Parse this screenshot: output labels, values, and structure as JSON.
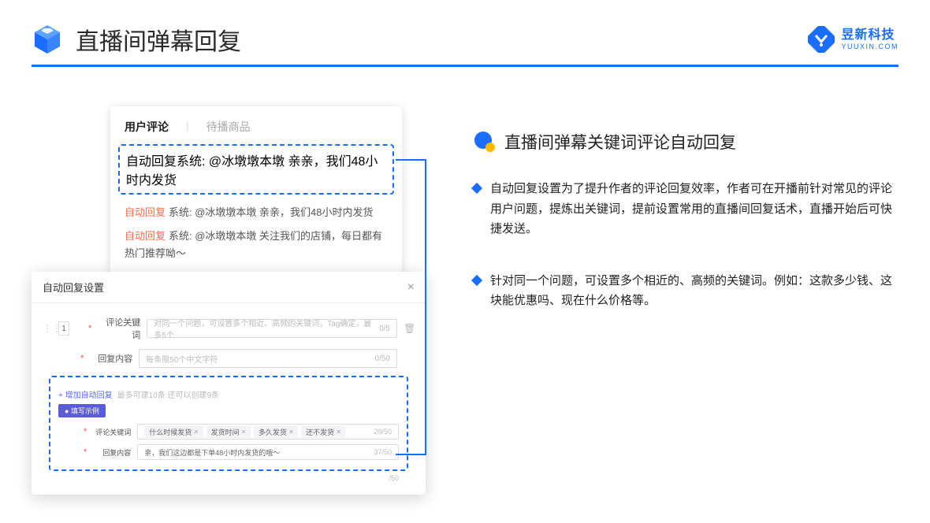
{
  "header": {
    "title": "直播间弹幕回复",
    "brand_name": "昱新科技",
    "brand_sub": "YUUXIN.COM"
  },
  "comments": {
    "tab_active": "用户评论",
    "tab_inactive": "待播商品",
    "items": [
      {
        "tag": "自动回复",
        "text": "系统: @冰墩墩本墩 亲亲，我们48小时内发货"
      },
      {
        "tag": "自动回复",
        "text": "系统: @冰墩墩本墩 亲亲，我们48小时内发货"
      },
      {
        "tag": "自动回复",
        "text": "系统: @冰墩墩本墩 关注我们的店铺，每日都有热门推荐呦～"
      }
    ]
  },
  "settings": {
    "title": "自动回复设置",
    "row_num": "1",
    "keyword_label": "评论关键词",
    "keyword_placeholder": "对同一个问题，可设置多个相近、高频的关键词，Tag确定，最多5个",
    "keyword_count": "0/5",
    "content_label": "回复内容",
    "content_placeholder": "每条限50个中文字符",
    "content_count": "0/50",
    "add_label": "+ 增加自动回复",
    "add_note": "最多可建10条 还可以创建9条",
    "example_badge": "● 填写示例",
    "ex_kw_label": "评论关键词",
    "ex_tags": [
      "什么时候发货",
      "发货时间",
      "多久发货",
      "还不发货"
    ],
    "ex_kw_count": "20/50",
    "ex_content_label": "回复内容",
    "ex_content": "亲，我们这边都是下单48小时内发货的哦～",
    "ex_content_count": "37/50",
    "outer_count": "/50"
  },
  "right": {
    "title": "直播间弹幕关键词评论自动回复",
    "bullets": [
      "自动回复设置为了提升作者的评论回复效率，作者可在开播前针对常见的评论用户问题，提炼出关键词，提前设置常用的直播间回复话术，直播开始后可快捷发送。",
      "针对同一个问题，可设置多个相近的、高频的关键词。例如：这款多少钱、这块能优惠吗、现在什么价格等。"
    ]
  }
}
